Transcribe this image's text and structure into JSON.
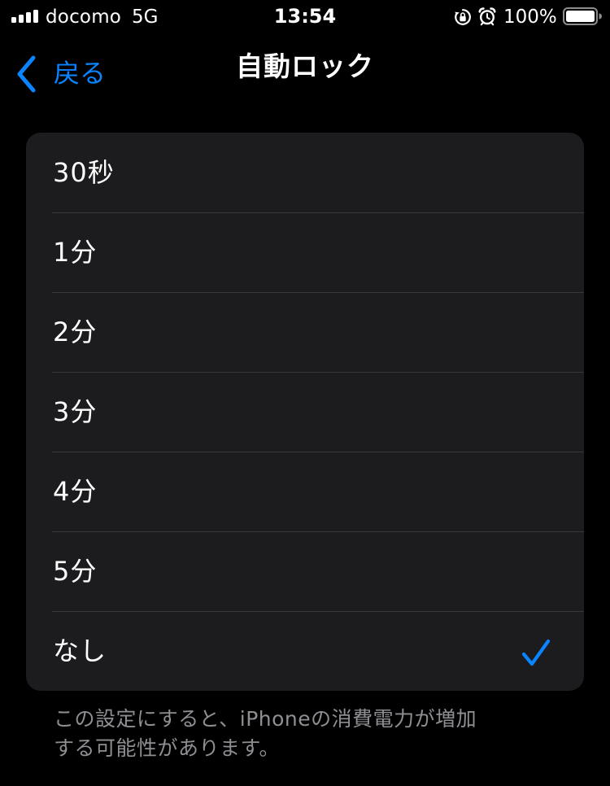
{
  "status_bar": {
    "carrier": "docomo",
    "network": "5G",
    "time": "13:54",
    "battery_percent": "100%",
    "icons": [
      "signal-icon",
      "orientation-lock-icon",
      "alarm-icon",
      "battery-icon"
    ]
  },
  "nav": {
    "back_label": "戻る",
    "title": "自動ロック",
    "back_icon": "chevron-left-icon"
  },
  "options": [
    {
      "label": "30秒",
      "selected": false
    },
    {
      "label": "1分",
      "selected": false
    },
    {
      "label": "2分",
      "selected": false
    },
    {
      "label": "3分",
      "selected": false
    },
    {
      "label": "4分",
      "selected": false
    },
    {
      "label": "5分",
      "selected": false
    },
    {
      "label": "なし",
      "selected": true
    }
  ],
  "footer": {
    "note_line1": "この設定にすると、iPhoneの消費電力が増加",
    "note_line2": "する可能性があります。"
  },
  "colors": {
    "accent": "#0a84ff",
    "background": "#000000",
    "cell_background": "#1c1c1e",
    "separator": "#38383a",
    "secondary_text": "#8e8e93"
  }
}
